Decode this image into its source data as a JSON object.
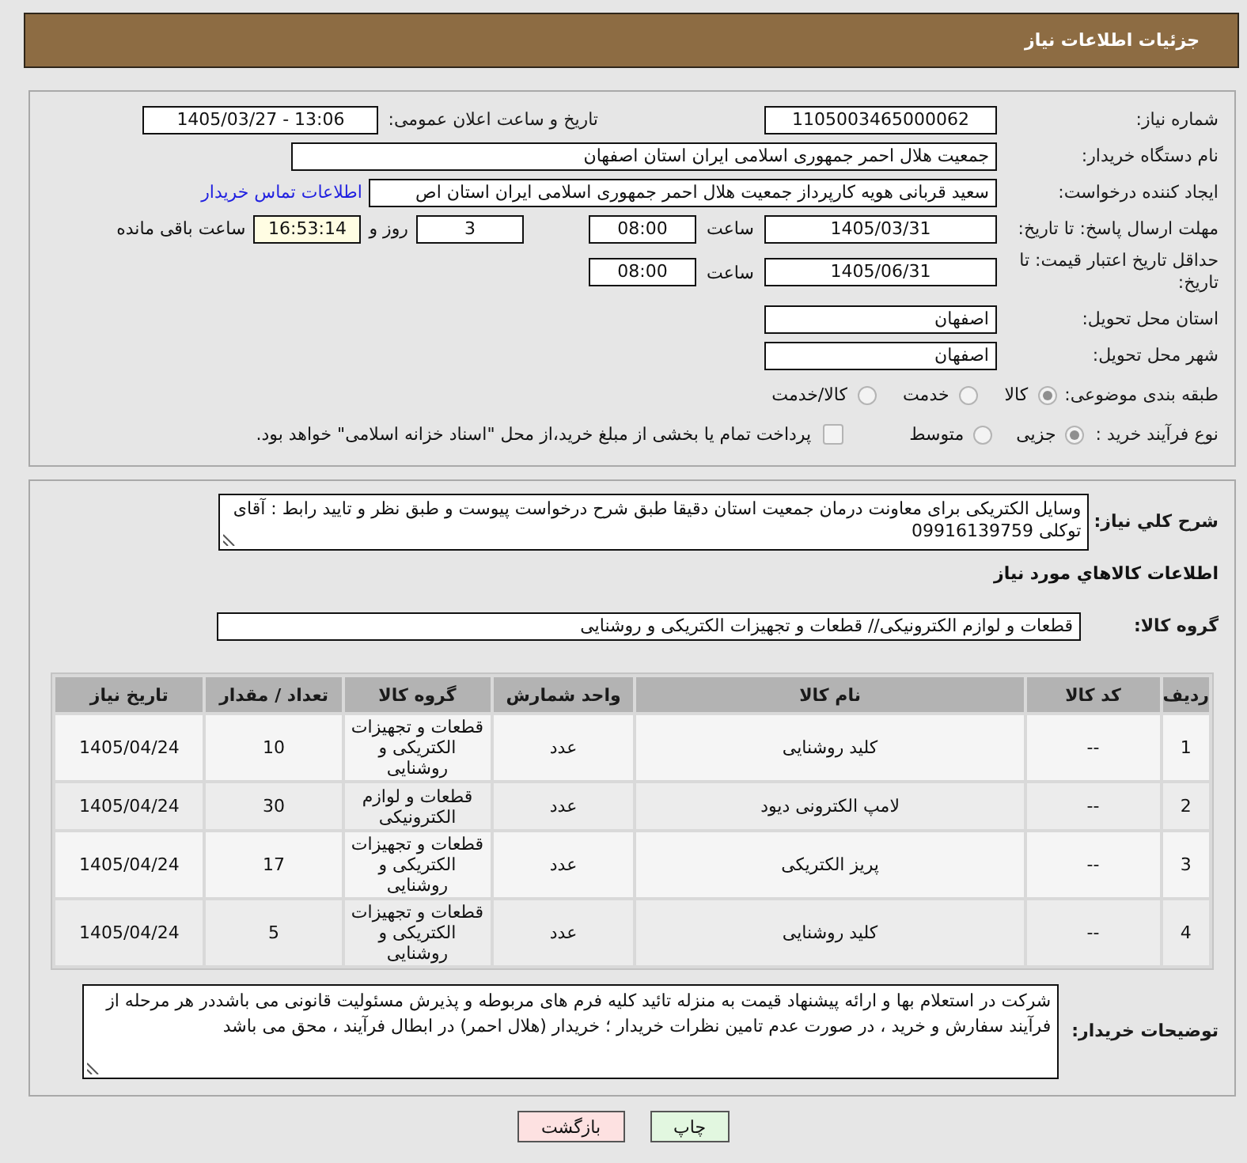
{
  "header": {
    "title": "جزئیات اطلاعات نیاز"
  },
  "details": {
    "need_number": {
      "label": "شماره نیاز:",
      "value": "1105003465000062"
    },
    "announce_datetime": {
      "label": "تاریخ و ساعت اعلان عمومی:",
      "value": "1405/03/27 - 13:06"
    },
    "buyer_org": {
      "label": "نام دستگاه خریدار:",
      "value": "جمعیت هلال احمر جمهوری اسلامی ایران استان اصفهان"
    },
    "requester": {
      "label": "ایجاد کننده درخواست:",
      "value": "سعید قربانی هویه کارپرداز جمعیت هلال احمر جمهوری اسلامی ایران استان اص",
      "link": "اطلاعات تماس خریدار"
    },
    "response_deadline": {
      "label": "مهلت ارسال پاسخ: تا تاریخ:",
      "date": "1405/03/31",
      "time_label": "ساعت",
      "time": "08:00",
      "days": "3",
      "days_label": "روز و",
      "remaining": "16:53:14",
      "remaining_label": "ساعت باقی مانده"
    },
    "price_validity": {
      "label": "حداقل تاریخ اعتبار قیمت: تا تاریخ:",
      "date": "1405/06/31",
      "time_label": "ساعت",
      "time": "08:00"
    },
    "delivery_province": {
      "label": "استان محل تحویل:",
      "value": "اصفهان"
    },
    "delivery_city": {
      "label": "شهر محل تحویل:",
      "value": "اصفهان"
    },
    "category": {
      "label": "طبقه بندی موضوعی:",
      "options": [
        {
          "label": "کالا",
          "selected": true
        },
        {
          "label": "خدمت",
          "selected": false
        },
        {
          "label": "کالا/خدمت",
          "selected": false
        }
      ]
    },
    "process_type": {
      "label": "نوع فرآیند خرید :",
      "options": [
        {
          "label": "جزیی",
          "selected": true
        },
        {
          "label": "متوسط",
          "selected": false
        }
      ],
      "treasury": {
        "label": "پرداخت تمام یا بخشی از مبلغ خرید،از محل \"اسناد خزانه اسلامی\" خواهد بود.",
        "checked": false
      }
    }
  },
  "description": {
    "label": "شرح کلي نياز:",
    "value": "وسایل الکتریکی برای معاونت درمان جمعیت استان دقیقا طبق شرح درخواست پیوست و طبق نظر و تایید رابط : آقای توکلی 09916139759"
  },
  "goods": {
    "title": "اطلاعات کالاهاي مورد نياز",
    "group": {
      "label": "گروه کالا:",
      "value": "قطعات و لوازم الکترونیکی// قطعات و تجهیزات الکتریکی و روشنایی"
    },
    "table": {
      "columns": [
        "ردیف",
        "کد کالا",
        "نام کالا",
        "واحد شمارش",
        "گروه کالا",
        "تعداد / مقدار",
        "تاریخ نیاز"
      ],
      "rows": [
        [
          "1",
          "--",
          "کلید روشنایی",
          "عدد",
          "قطعات و تجهیزات الکتریکی و روشنایی",
          "10",
          "1405/04/24"
        ],
        [
          "2",
          "--",
          "لامپ الکترونی دیود",
          "عدد",
          "قطعات و لوازم الکترونیکی",
          "30",
          "1405/04/24"
        ],
        [
          "3",
          "--",
          "پریز الکتریکی",
          "عدد",
          "قطعات و تجهیزات الکتریکی و روشنایی",
          "17",
          "1405/04/24"
        ],
        [
          "4",
          "--",
          "کلید روشنایی",
          "عدد",
          "قطعات و تجهیزات الکتریکی و روشنایی",
          "5",
          "1405/04/24"
        ]
      ]
    }
  },
  "buyer_notes": {
    "label": "توضیحات خریدار:",
    "value": "شرکت در استعلام بها و ارائه پیشنهاد قیمت به منزله تائید کلیه فرم های مربوطه و پذیرش مسئولیت قانونی می باشددر هر مرحله از فرآیند سفارش و خرید ، در صورت عدم تامین نظرات خریدار ؛ خریدار (هلال احمر) در ابطال فرآیند ، محق می باشد"
  },
  "buttons": [
    {
      "label": "چاپ",
      "kind": "print"
    },
    {
      "label": "بازگشت",
      "kind": "back"
    }
  ]
}
